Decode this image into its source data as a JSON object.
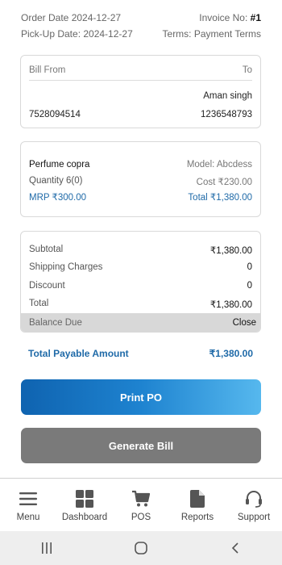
{
  "header": {
    "order_date": "Order Date 2024-12-27",
    "invoice_label": "Invoice No: ",
    "invoice_no": "#1",
    "pickup_date": "Pick-Up Date: 2024-12-27",
    "terms": "Terms: Payment Terms"
  },
  "bill": {
    "from_label": "Bill From",
    "to_label": "To",
    "to_name": "Aman singh",
    "from_phone": "7528094514",
    "to_phone": "1236548793"
  },
  "item": {
    "name": "Perfume copra",
    "model": "Model: Abcdess",
    "quantity": "Quantity 6(0)",
    "cost": "Cost ₹230.00",
    "mrp": "MRP ₹300.00",
    "total": "Total ₹1,380.00"
  },
  "summary": {
    "subtotal_label": "Subtotal",
    "subtotal": "₹1,380.00",
    "shipping_label": "Shipping Charges",
    "shipping": "0",
    "discount_label": "Discount",
    "discount": "0",
    "total_label": "Total",
    "total": "₹1,380.00",
    "balance_label": "Balance Due",
    "balance_value": "Close"
  },
  "payable": {
    "label": "Total Payable Amount",
    "value": "₹1,380.00"
  },
  "buttons": {
    "print": "Print PO",
    "generate": "Generate Bill"
  },
  "nav": [
    {
      "label": "Menu",
      "icon": "menu-icon"
    },
    {
      "label": "Dashboard",
      "icon": "dashboard-icon"
    },
    {
      "label": "POS",
      "icon": "cart-icon"
    },
    {
      "label": "Reports",
      "icon": "document-icon"
    },
    {
      "label": "Support",
      "icon": "headset-icon"
    }
  ],
  "colors": {
    "accent": "#1f6aa8",
    "print_button": "#1e83d0",
    "generate_button": "#7a7a7a"
  }
}
